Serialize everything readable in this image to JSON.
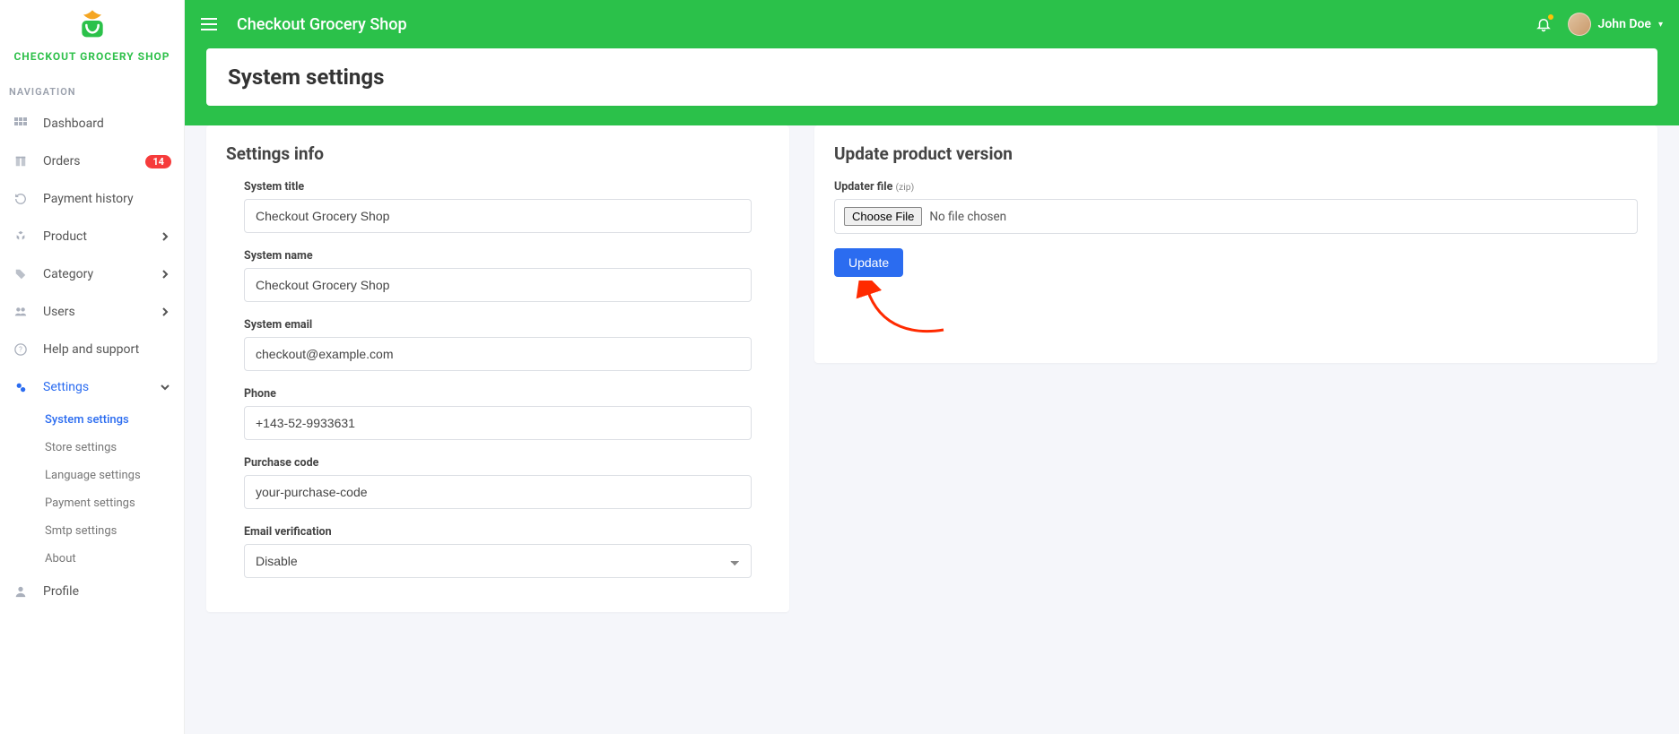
{
  "brand": "CHECKOUT GROCERY SHOP",
  "nav_heading": "NAVIGATION",
  "sidebar": {
    "dashboard": "Dashboard",
    "orders": "Orders",
    "orders_badge": "14",
    "payment_history": "Payment history",
    "product": "Product",
    "category": "Category",
    "users": "Users",
    "help": "Help and support",
    "settings": "Settings",
    "profile": "Profile",
    "settings_sub": {
      "system": "System settings",
      "store": "Store settings",
      "language": "Language settings",
      "payment": "Payment settings",
      "smtp": "Smtp settings",
      "about": "About"
    }
  },
  "topbar": {
    "title": "Checkout Grocery Shop",
    "user": "John Doe"
  },
  "page": {
    "title": "System settings"
  },
  "settings_card": {
    "heading": "Settings info",
    "labels": {
      "system_title": "System title",
      "system_name": "System name",
      "system_email": "System email",
      "phone": "Phone",
      "purchase_code": "Purchase code",
      "email_verification": "Email verification"
    },
    "values": {
      "system_title": "Checkout Grocery Shop",
      "system_name": "Checkout Grocery Shop",
      "system_email": "checkout@example.com",
      "phone": "+143-52-9933631",
      "purchase_code": "your-purchase-code",
      "email_verification": "Disable"
    }
  },
  "update_card": {
    "heading": "Update product version",
    "file_label": "Updater file",
    "file_hint": "(zip)",
    "choose_btn": "Choose File",
    "no_file": "No file chosen",
    "update_btn": "Update"
  }
}
